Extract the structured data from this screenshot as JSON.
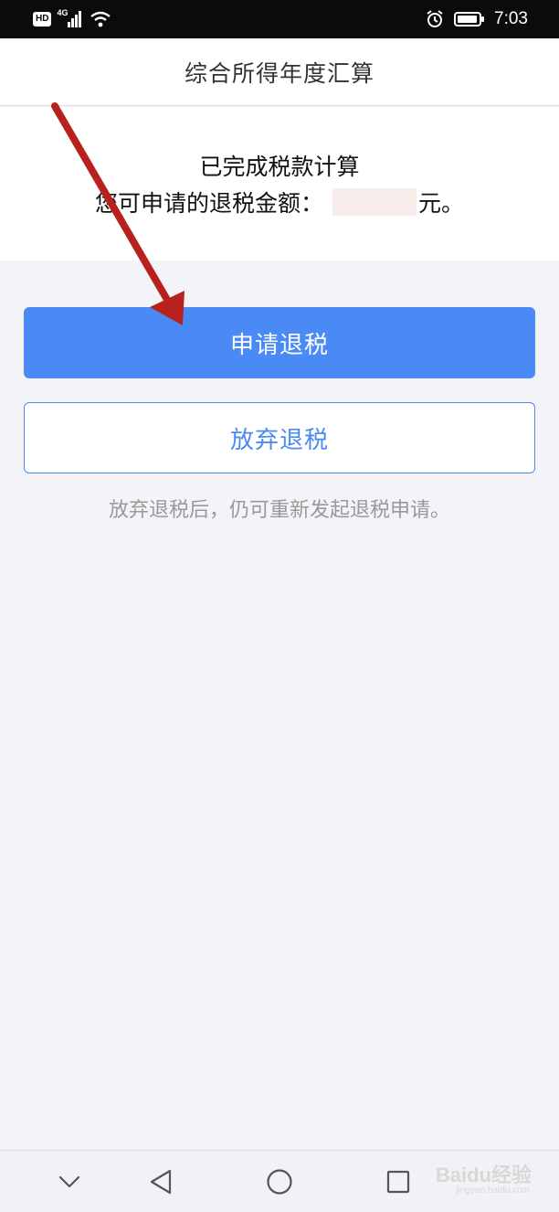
{
  "status_bar": {
    "hd_label": "HD",
    "network_label": "4G",
    "time": "7:03",
    "icons": [
      "signal-icon",
      "wifi-icon",
      "alarm-icon",
      "battery-icon"
    ]
  },
  "header": {
    "title": "综合所得年度汇算"
  },
  "result": {
    "title": "已完成税款计算",
    "refund_prefix": "您可申请的退税金额：",
    "refund_suffix": "元。"
  },
  "actions": {
    "apply_label": "申请退税",
    "abandon_label": "放弃退税",
    "hint": "放弃退税后，仍可重新发起退税申请。"
  },
  "nav_bar": {
    "icons": [
      "chevron-down-icon",
      "back-triangle-icon",
      "home-circle-icon",
      "recents-square-icon"
    ]
  },
  "watermark": {
    "brand": "Baidu经验",
    "sub": "jingyan.baidu.com"
  },
  "colors": {
    "primary": "#4a8af4",
    "annotation_arrow": "#b8221e",
    "background": "#f3f4f8"
  }
}
